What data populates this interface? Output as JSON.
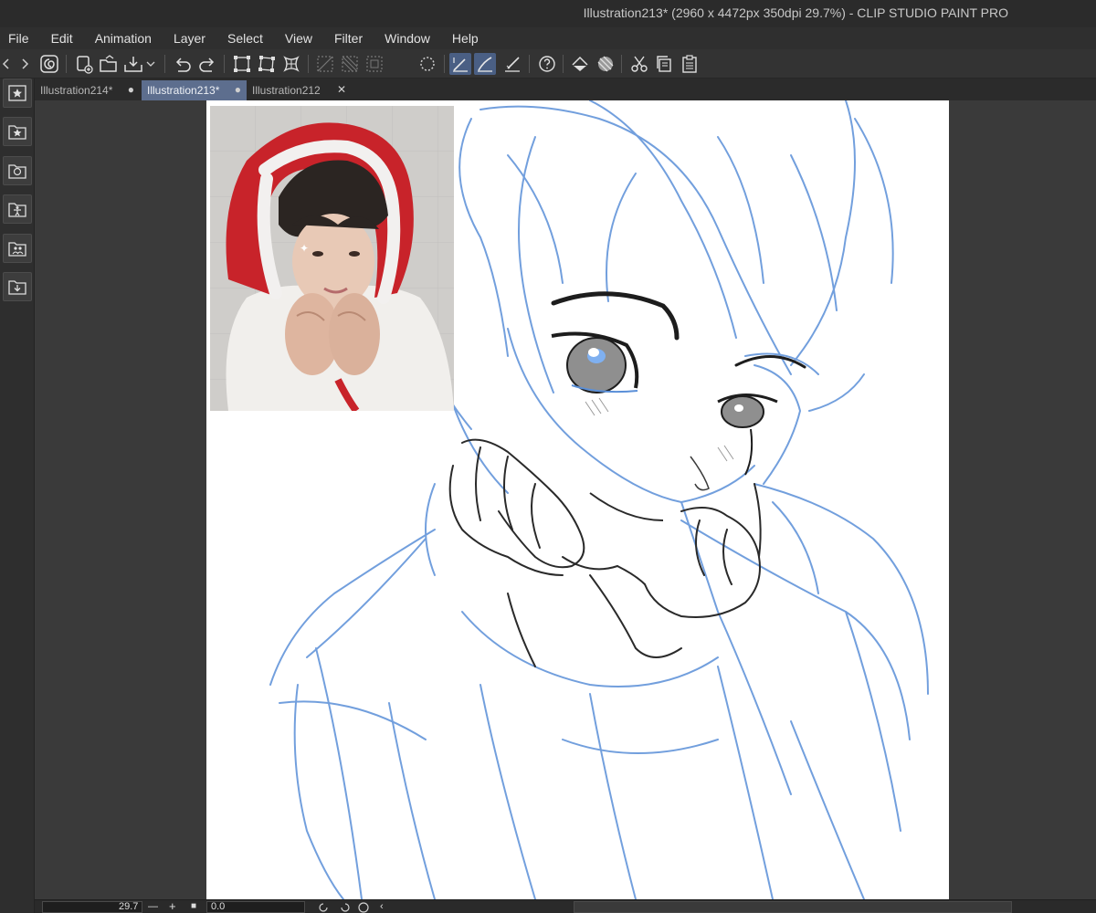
{
  "window": {
    "title": "Illustration213* (2960 x 4472px 350dpi 29.7%)  - CLIP STUDIO PAINT PRO"
  },
  "menu": {
    "items": [
      "File",
      "Edit",
      "Animation",
      "Layer",
      "Select",
      "View",
      "Filter",
      "Window",
      "Help"
    ]
  },
  "toolbar": {
    "icons": [
      "back-icon",
      "forward-icon",
      "clip-studio-icon",
      "new-icon",
      "open-icon",
      "save-icon",
      "save-dropdown-icon",
      "undo-icon",
      "redo-icon",
      "transform-icon",
      "free-transform-icon",
      "mesh-transform-icon",
      "clear-selection-icon",
      "invert-selection-icon",
      "select-all-icon",
      "deselect-icon",
      "pen-snap-icon",
      "brush-snap-icon",
      "ruler-snap-icon",
      "help-icon",
      "fill-icon",
      "tone-icon",
      "cut-icon",
      "copy-icon",
      "paste-icon"
    ]
  },
  "left_panel": {
    "icons": [
      "favorite-star-icon",
      "material-star-icon",
      "material-image-icon",
      "pose-figure-icon",
      "character-icon",
      "download-icon"
    ]
  },
  "tabs": [
    {
      "label": "Illustration214*",
      "indicator": "●",
      "active": false
    },
    {
      "label": "Illustration213*",
      "indicator": "●",
      "active": true
    },
    {
      "label": "Illustration212",
      "indicator": "✕",
      "active": false
    }
  ],
  "statusbar": {
    "zoom": "29.7",
    "minus": "—",
    "plus": "+",
    "stop": "■",
    "angle": "0.0"
  },
  "colors": {
    "sketch_blue": "#5a8fd8",
    "lineart": "#1d1d1d",
    "hood_red": "#c8232a",
    "active_tab": "#5d6e8e"
  }
}
